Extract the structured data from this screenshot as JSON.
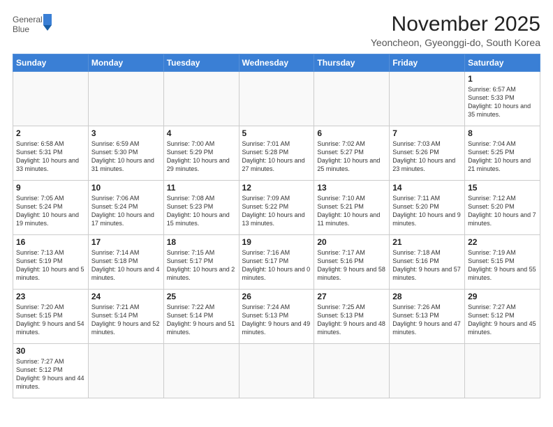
{
  "logo": {
    "line1": "General",
    "line2": "Blue"
  },
  "title": "November 2025",
  "location": "Yeoncheon, Gyeonggi-do, South Korea",
  "weekdays": [
    "Sunday",
    "Monday",
    "Tuesday",
    "Wednesday",
    "Thursday",
    "Friday",
    "Saturday"
  ],
  "weeks": [
    [
      {
        "day": "",
        "info": ""
      },
      {
        "day": "",
        "info": ""
      },
      {
        "day": "",
        "info": ""
      },
      {
        "day": "",
        "info": ""
      },
      {
        "day": "",
        "info": ""
      },
      {
        "day": "",
        "info": ""
      },
      {
        "day": "1",
        "info": "Sunrise: 6:57 AM\nSunset: 5:33 PM\nDaylight: 10 hours and 35 minutes."
      }
    ],
    [
      {
        "day": "2",
        "info": "Sunrise: 6:58 AM\nSunset: 5:31 PM\nDaylight: 10 hours and 33 minutes."
      },
      {
        "day": "3",
        "info": "Sunrise: 6:59 AM\nSunset: 5:30 PM\nDaylight: 10 hours and 31 minutes."
      },
      {
        "day": "4",
        "info": "Sunrise: 7:00 AM\nSunset: 5:29 PM\nDaylight: 10 hours and 29 minutes."
      },
      {
        "day": "5",
        "info": "Sunrise: 7:01 AM\nSunset: 5:28 PM\nDaylight: 10 hours and 27 minutes."
      },
      {
        "day": "6",
        "info": "Sunrise: 7:02 AM\nSunset: 5:27 PM\nDaylight: 10 hours and 25 minutes."
      },
      {
        "day": "7",
        "info": "Sunrise: 7:03 AM\nSunset: 5:26 PM\nDaylight: 10 hours and 23 minutes."
      },
      {
        "day": "8",
        "info": "Sunrise: 7:04 AM\nSunset: 5:25 PM\nDaylight: 10 hours and 21 minutes."
      }
    ],
    [
      {
        "day": "9",
        "info": "Sunrise: 7:05 AM\nSunset: 5:24 PM\nDaylight: 10 hours and 19 minutes."
      },
      {
        "day": "10",
        "info": "Sunrise: 7:06 AM\nSunset: 5:24 PM\nDaylight: 10 hours and 17 minutes."
      },
      {
        "day": "11",
        "info": "Sunrise: 7:08 AM\nSunset: 5:23 PM\nDaylight: 10 hours and 15 minutes."
      },
      {
        "day": "12",
        "info": "Sunrise: 7:09 AM\nSunset: 5:22 PM\nDaylight: 10 hours and 13 minutes."
      },
      {
        "day": "13",
        "info": "Sunrise: 7:10 AM\nSunset: 5:21 PM\nDaylight: 10 hours and 11 minutes."
      },
      {
        "day": "14",
        "info": "Sunrise: 7:11 AM\nSunset: 5:20 PM\nDaylight: 10 hours and 9 minutes."
      },
      {
        "day": "15",
        "info": "Sunrise: 7:12 AM\nSunset: 5:20 PM\nDaylight: 10 hours and 7 minutes."
      }
    ],
    [
      {
        "day": "16",
        "info": "Sunrise: 7:13 AM\nSunset: 5:19 PM\nDaylight: 10 hours and 5 minutes."
      },
      {
        "day": "17",
        "info": "Sunrise: 7:14 AM\nSunset: 5:18 PM\nDaylight: 10 hours and 4 minutes."
      },
      {
        "day": "18",
        "info": "Sunrise: 7:15 AM\nSunset: 5:17 PM\nDaylight: 10 hours and 2 minutes."
      },
      {
        "day": "19",
        "info": "Sunrise: 7:16 AM\nSunset: 5:17 PM\nDaylight: 10 hours and 0 minutes."
      },
      {
        "day": "20",
        "info": "Sunrise: 7:17 AM\nSunset: 5:16 PM\nDaylight: 9 hours and 58 minutes."
      },
      {
        "day": "21",
        "info": "Sunrise: 7:18 AM\nSunset: 5:16 PM\nDaylight: 9 hours and 57 minutes."
      },
      {
        "day": "22",
        "info": "Sunrise: 7:19 AM\nSunset: 5:15 PM\nDaylight: 9 hours and 55 minutes."
      }
    ],
    [
      {
        "day": "23",
        "info": "Sunrise: 7:20 AM\nSunset: 5:15 PM\nDaylight: 9 hours and 54 minutes."
      },
      {
        "day": "24",
        "info": "Sunrise: 7:21 AM\nSunset: 5:14 PM\nDaylight: 9 hours and 52 minutes."
      },
      {
        "day": "25",
        "info": "Sunrise: 7:22 AM\nSunset: 5:14 PM\nDaylight: 9 hours and 51 minutes."
      },
      {
        "day": "26",
        "info": "Sunrise: 7:24 AM\nSunset: 5:13 PM\nDaylight: 9 hours and 49 minutes."
      },
      {
        "day": "27",
        "info": "Sunrise: 7:25 AM\nSunset: 5:13 PM\nDaylight: 9 hours and 48 minutes."
      },
      {
        "day": "28",
        "info": "Sunrise: 7:26 AM\nSunset: 5:13 PM\nDaylight: 9 hours and 47 minutes."
      },
      {
        "day": "29",
        "info": "Sunrise: 7:27 AM\nSunset: 5:12 PM\nDaylight: 9 hours and 45 minutes."
      }
    ],
    [
      {
        "day": "30",
        "info": "Sunrise: 7:27 AM\nSunset: 5:12 PM\nDaylight: 9 hours and 44 minutes."
      },
      {
        "day": "",
        "info": ""
      },
      {
        "day": "",
        "info": ""
      },
      {
        "day": "",
        "info": ""
      },
      {
        "day": "",
        "info": ""
      },
      {
        "day": "",
        "info": ""
      },
      {
        "day": "",
        "info": ""
      }
    ]
  ]
}
